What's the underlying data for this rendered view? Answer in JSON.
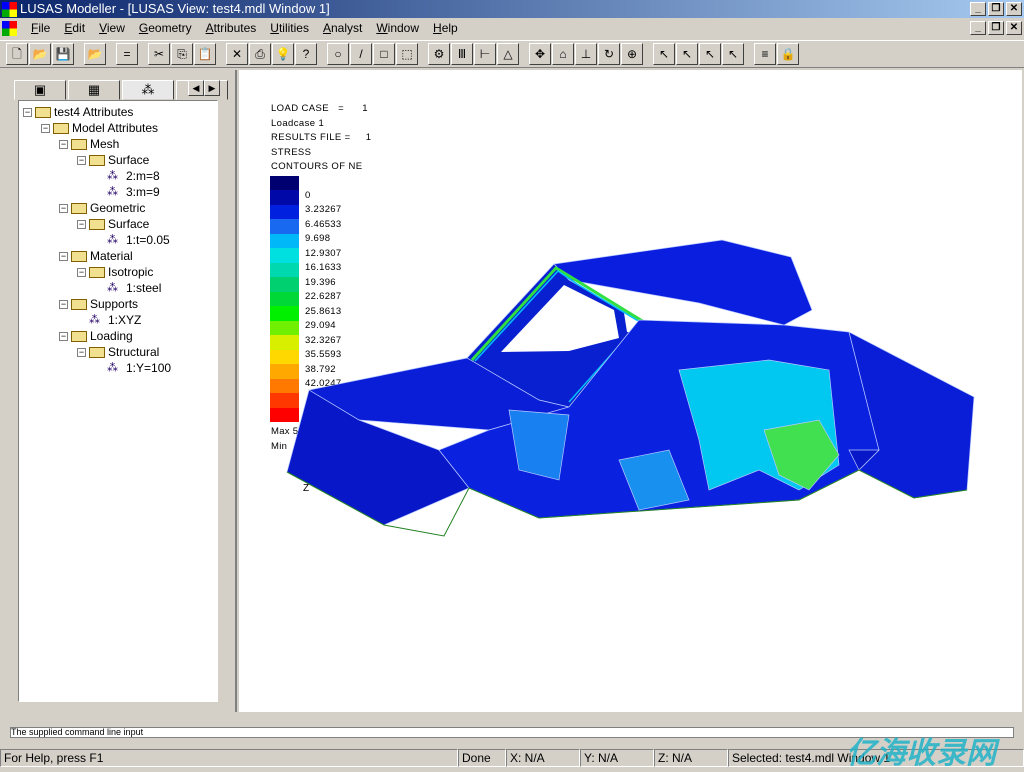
{
  "window": {
    "title": "LUSAS Modeller - [LUSAS View: test4.mdl Window 1]"
  },
  "menu": [
    "File",
    "Edit",
    "View",
    "Geometry",
    "Attributes",
    "Utilities",
    "Analyst",
    "Window",
    "Help"
  ],
  "toolbar_icons": [
    "new-icon",
    "open-icon",
    "save-icon",
    "open-folder-icon",
    "equals-icon",
    "cut-icon",
    "copy-icon",
    "paste-icon",
    "delete-icon",
    "print-icon",
    "lightbulb-icon",
    "context-help-icon",
    "point-icon",
    "line-icon",
    "surface-icon",
    "volume-icon",
    "group-icon",
    "support-icon",
    "load-icon",
    "mesh-icon",
    "pan-icon",
    "home-icon",
    "axes-icon",
    "rotate-icon",
    "zoom-icon",
    "select-icon",
    "select-curve-icon",
    "select-node-icon",
    "select-add-icon",
    "contour-icon",
    "lock-icon"
  ],
  "left_tabs": [
    "layers-icon",
    "treeview-icon",
    "attributes-icon",
    "loadcase-icon"
  ],
  "tree": [
    {
      "label": "test4 Attributes",
      "level": 0,
      "type": "folder"
    },
    {
      "label": "Model Attributes",
      "level": 1,
      "type": "folder"
    },
    {
      "label": "Mesh",
      "level": 2,
      "type": "folder"
    },
    {
      "label": "Surface",
      "level": 3,
      "type": "folder"
    },
    {
      "label": "2:m=8",
      "level": 4,
      "type": "attr"
    },
    {
      "label": "3:m=9",
      "level": 4,
      "type": "attr"
    },
    {
      "label": "Geometric",
      "level": 2,
      "type": "folder"
    },
    {
      "label": "Surface",
      "level": 3,
      "type": "folder"
    },
    {
      "label": "1:t=0.05",
      "level": 4,
      "type": "attr"
    },
    {
      "label": "Material",
      "level": 2,
      "type": "folder"
    },
    {
      "label": "Isotropic",
      "level": 3,
      "type": "folder"
    },
    {
      "label": "1:steel",
      "level": 4,
      "type": "attr"
    },
    {
      "label": "Supports",
      "level": 2,
      "type": "folder"
    },
    {
      "label": "1:XYZ",
      "level": 3,
      "type": "attr"
    },
    {
      "label": "Loading",
      "level": 2,
      "type": "folder"
    },
    {
      "label": "Structural",
      "level": 3,
      "type": "folder"
    },
    {
      "label": "1:Y=100",
      "level": 4,
      "type": "attr"
    }
  ],
  "view": {
    "info": [
      "LOAD CASE   =      1",
      "Loadcase 1",
      "RESULTS FILE =     1",
      "STRESS",
      "CONTOURS OF NE"
    ],
    "legend_colors": [
      "#000070",
      "#0008a8",
      "#0020e0",
      "#1868f0",
      "#00b8f8",
      "#00e0e0",
      "#00d8b0",
      "#00d070",
      "#00d838",
      "#00f000",
      "#70f000",
      "#d8f000",
      "#ffd800",
      "#ffa800",
      "#ff7800",
      "#ff3800",
      "#ff0000"
    ],
    "legend_labels": [
      "0",
      "3.23267",
      "6.46533",
      "9.698",
      "12.9307",
      "16.1633",
      "19.396",
      "22.6287",
      "25.8613",
      "29.094",
      "32.3267",
      "35.5593",
      "38.792",
      "42.0247"
    ],
    "max_label": "Max 5",
    "min_label": "Min",
    "axis_label": "Z"
  },
  "command_line": "The supplied command line input",
  "status": {
    "help": "For Help, press F1",
    "state": "Done",
    "x": "X: N/A",
    "y": "Y: N/A",
    "z": "Z: N/A",
    "selected": "Selected: test4.mdl Window 1"
  },
  "watermark": "亿海收录网"
}
